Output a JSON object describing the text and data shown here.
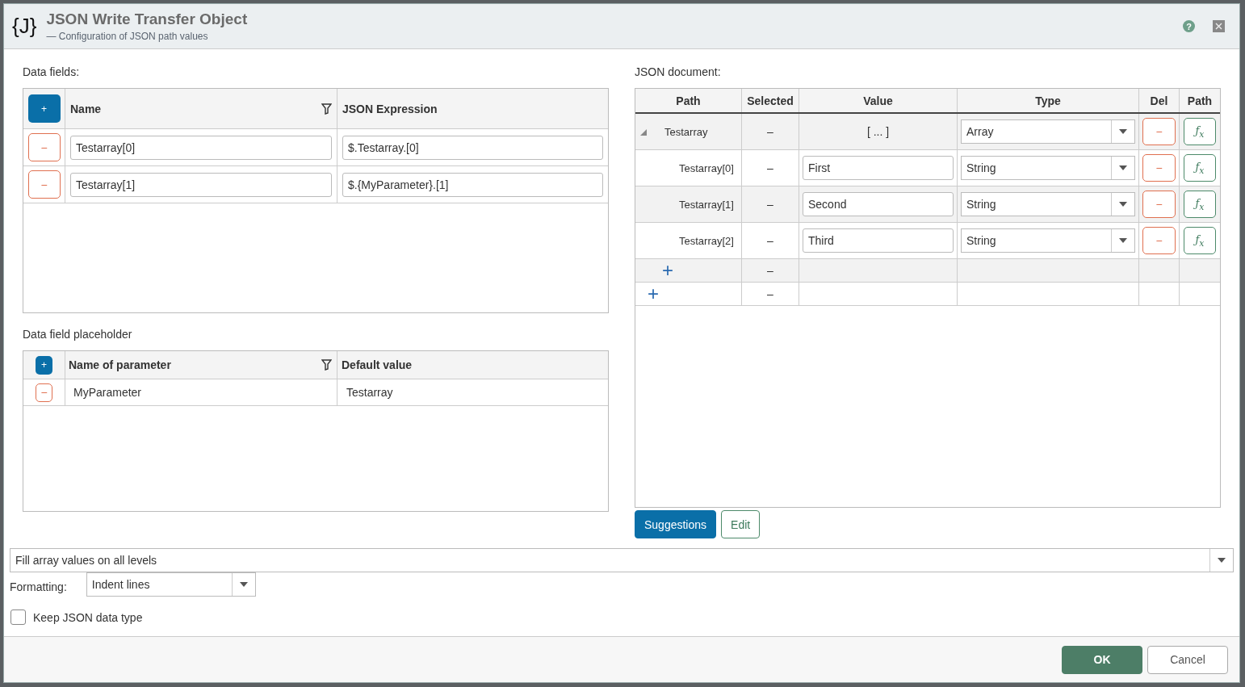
{
  "dialog": {
    "logo": "{J}",
    "title": "JSON Write Transfer Object",
    "subtitle": "— Configuration of JSON path values",
    "help_button": "?"
  },
  "data_fields": {
    "label": "Data fields:",
    "add_button": "+",
    "columns": [
      "Name",
      "JSON Expression"
    ],
    "rows": [
      {
        "remove_button": "−",
        "name": "Testarray[0]",
        "expression": "$.Testarray.[0]"
      },
      {
        "remove_button": "−",
        "name": "Testarray[1]",
        "expression": "$.{MyParameter}.[1]"
      }
    ]
  },
  "placeholders": {
    "label": "Data field placeholder",
    "add_button": "+",
    "columns": [
      "Name of parameter",
      "Default value"
    ],
    "rows": [
      {
        "remove_button": "−",
        "name": "MyParameter",
        "default_value": "Testarray"
      }
    ]
  },
  "json_document": {
    "label": "JSON document:",
    "columns": [
      "Path",
      "Selected",
      "Value",
      "Type",
      "Del",
      "Path"
    ],
    "rows": [
      {
        "kind": "node",
        "path": "Testarray",
        "selected": "–",
        "value": "[ ... ]",
        "type": "Array",
        "del_button": "−",
        "path_button": "ƒ$_{x}$",
        "expanded": true,
        "children": [
          {
            "kind": "node",
            "path": "Testarray[0]",
            "selected": "–",
            "value": "First",
            "type": "String",
            "del_button": "−",
            "path_button": "ƒ$_{x}$"
          },
          {
            "kind": "node",
            "path": "Testarray[1]",
            "selected": "–",
            "value": "Second",
            "type": "String",
            "del_button": "−",
            "path_button": "ƒ$_{x}$"
          },
          {
            "kind": "node",
            "path": "Testarray[2]",
            "selected": "–",
            "value": "Third",
            "type": "String",
            "del_button": "−",
            "path_button": "ƒ$_{x}$"
          },
          {
            "kind": "add",
            "add_button": "+",
            "selected": "–"
          }
        ]
      },
      {
        "kind": "add",
        "add_button": "+",
        "selected": "–"
      }
    ],
    "buttons": [
      {
        "label": "Suggestions",
        "primary": true
      },
      {
        "label": "Edit",
        "primary": false
      }
    ]
  },
  "fill_mode": {
    "value": "Fill array values on all levels"
  },
  "formatting": {
    "label": "Formatting:",
    "value": "Indent lines"
  },
  "keep_type": {
    "label": "Keep JSON data type",
    "checked": false
  },
  "footer": {
    "buttons": [
      {
        "label": "OK",
        "primary": true
      },
      {
        "label": "Cancel",
        "primary": false
      }
    ]
  }
}
